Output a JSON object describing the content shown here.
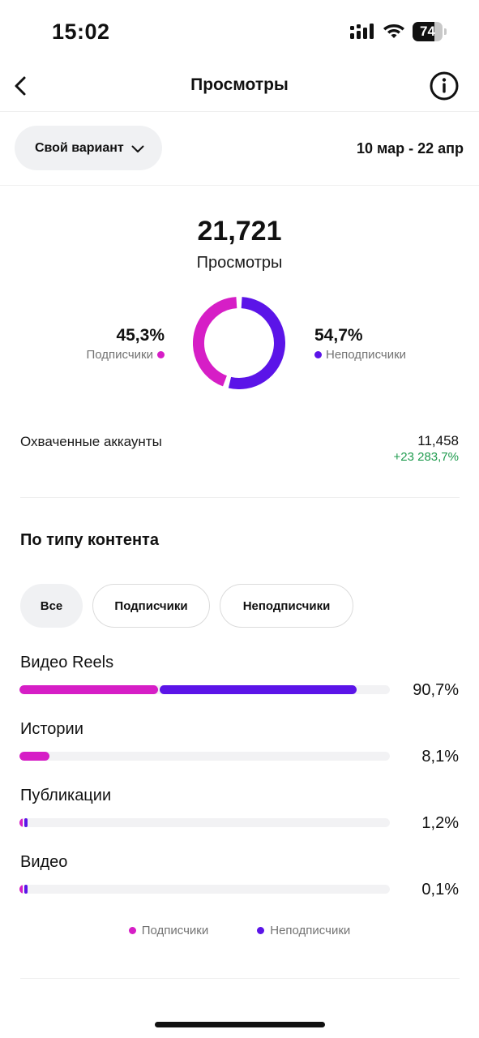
{
  "status_bar": {
    "time": "15:02",
    "battery": "74",
    "battery_level": 0.74
  },
  "header": {
    "title": "Просмотры",
    "back_icon": "chevron-left-icon",
    "info_icon": "info-circle-icon"
  },
  "filters": {
    "range_label": "Свой вариант",
    "date_range": "10 мар - 22 апр"
  },
  "summary": {
    "total": "21,721",
    "total_label": "Просмотры",
    "followers_pct": "45,3%",
    "followers_label": "Подписчики",
    "followers_share": 0.453,
    "non_followers_pct": "54,7%",
    "non_followers_label": "Неподписчики",
    "non_followers_share": 0.547
  },
  "reach": {
    "label": "Охваченные аккаунты",
    "value": "11,458",
    "delta": "+23 283,7%"
  },
  "content_type": {
    "title": "По типу контента",
    "chips": [
      "Все",
      "Подписчики",
      "Неподписчики"
    ],
    "rows": [
      {
        "label": "Видео Reels",
        "pct": "90,7%",
        "followers": 0.375,
        "non_followers": 0.532
      },
      {
        "label": "Истории",
        "pct": "8,1%",
        "followers": 0.081,
        "non_followers": 0.0
      },
      {
        "label": "Публикации",
        "pct": "1,2%",
        "followers": 0.004,
        "non_followers": 0.008
      },
      {
        "label": "Видео",
        "pct": "0,1%",
        "followers": 0.0005,
        "non_followers": 0.0005
      }
    ],
    "legend": [
      "Подписчики",
      "Неподписчики"
    ]
  },
  "colors": {
    "followers": "#d61ec6",
    "non_followers": "#5b14e8",
    "positive": "#1f9b4e"
  }
}
